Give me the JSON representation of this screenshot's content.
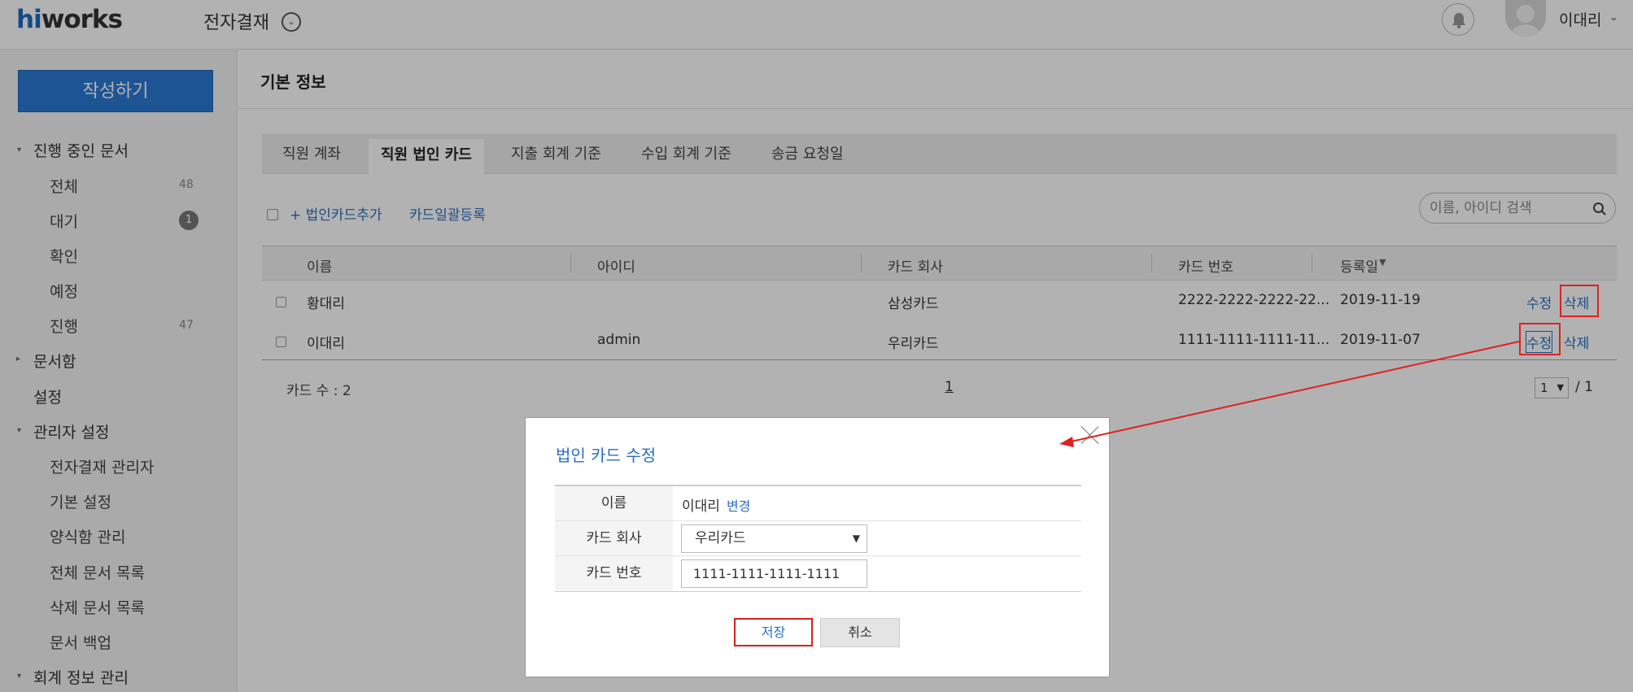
{
  "header": {
    "logo_hi": "hi",
    "logo_rest": "works",
    "app_title": "전자결재",
    "user_name": "이대리"
  },
  "sidebar": {
    "write_button": "작성하기",
    "items": [
      {
        "label": "진행 중인 문서"
      },
      {
        "label": "전체",
        "count": "48"
      },
      {
        "label": "대기",
        "badge": "1"
      },
      {
        "label": "확인"
      },
      {
        "label": "예정"
      },
      {
        "label": "진행",
        "count": "47"
      },
      {
        "label": "문서함"
      },
      {
        "label": "설정"
      },
      {
        "label": "관리자 설정"
      },
      {
        "label": "전자결재 관리자"
      },
      {
        "label": "기본 설정"
      },
      {
        "label": "양식함 관리"
      },
      {
        "label": "전체 문서 목록"
      },
      {
        "label": "삭제 문서 목록"
      },
      {
        "label": "문서 백업"
      },
      {
        "label": "회계 정보 관리"
      }
    ]
  },
  "main": {
    "page_title": "기본 정보",
    "tabs": [
      {
        "label": "직원 계좌"
      },
      {
        "label": "직원 법인 카드"
      },
      {
        "label": "지출 회계 기준"
      },
      {
        "label": "수입 회계 기준"
      },
      {
        "label": "송금 요청일"
      }
    ],
    "toolbar": {
      "add_card": "+ 법인카드추가",
      "bulk_register": "카드일괄등록",
      "search_placeholder": "이름, 아이디 검색"
    },
    "table": {
      "headers": [
        "이름",
        "아이디",
        "카드 회사",
        "카드 번호",
        "등록일"
      ],
      "rows": [
        {
          "name": "황대리",
          "id": "",
          "company": "삼성카드",
          "card": "2222-2222-2222-22...",
          "date": "2019-11-19",
          "edit": "수정",
          "delete": "삭제"
        },
        {
          "name": "이대리",
          "id": "admin",
          "company": "우리카드",
          "card": "1111-1111-1111-11...",
          "date": "2019-11-07",
          "edit": "수정",
          "delete": "삭제"
        }
      ]
    },
    "footer": {
      "card_count": "카드 수 : 2",
      "page": "1",
      "page_select": "1",
      "page_total": "/ 1"
    }
  },
  "modal": {
    "title": "법인 카드 수정",
    "rows": [
      {
        "label": "이름",
        "value": "이대리",
        "link": "변경"
      },
      {
        "label": "카드 회사",
        "select": "우리카드"
      },
      {
        "label": "카드 번호",
        "input": "1111-1111-1111-1111"
      }
    ],
    "save": "저장",
    "cancel": "취소"
  },
  "colors": {
    "accent": "#2a6fbf",
    "brand": "#2a7ad4",
    "highlight": "#e02020"
  }
}
